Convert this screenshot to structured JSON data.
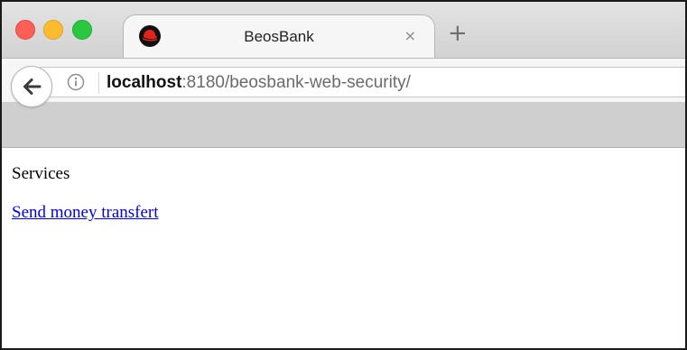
{
  "window": {
    "controls": [
      "close",
      "minimize",
      "zoom"
    ]
  },
  "tab": {
    "title": "BeosBank",
    "favicon": "redhat-logo-icon",
    "close_label": "×"
  },
  "new_tab": {
    "label": "+"
  },
  "toolbar": {
    "back_icon": "back-arrow-icon",
    "info_icon": "info-icon"
  },
  "address_bar": {
    "host": "localhost",
    "path": ":8180/beosbank-web-security/"
  },
  "page": {
    "heading": "Services",
    "link_label": "Send money transfert"
  },
  "colors": {
    "link": "#0000ee",
    "close_button": "#fc5f57",
    "minimize_button": "#fdbc2e",
    "zoom_button": "#28c840"
  }
}
